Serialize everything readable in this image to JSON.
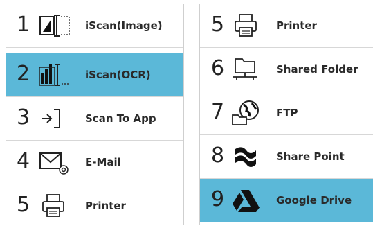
{
  "left_panel": {
    "items": [
      {
        "number": "1",
        "label": "iScan(Image)",
        "icon": "iscan-image-icon"
      },
      {
        "number": "2",
        "label": "iScan(OCR)",
        "icon": "iscan-ocr-icon",
        "selected": true
      },
      {
        "number": "3",
        "label": "Scan To App",
        "icon": "scan-to-app-icon"
      },
      {
        "number": "4",
        "label": "E-Mail",
        "icon": "email-icon"
      },
      {
        "number": "5",
        "label": "Printer",
        "icon": "printer-icon"
      }
    ]
  },
  "right_panel": {
    "items": [
      {
        "number": "5",
        "label": "Printer",
        "icon": "printer-icon"
      },
      {
        "number": "6",
        "label": "Shared Folder",
        "icon": "shared-folder-icon"
      },
      {
        "number": "7",
        "label": "FTP",
        "icon": "ftp-globe-icon"
      },
      {
        "number": "8",
        "label": "Share Point",
        "icon": "sharepoint-icon"
      },
      {
        "number": "9",
        "label": "Google Drive",
        "icon": "google-drive-icon",
        "selected": true
      }
    ]
  },
  "colors": {
    "selected_bg": "#5bb8d8",
    "text": "#2a2a2a",
    "divider": "#d7d7d7"
  }
}
